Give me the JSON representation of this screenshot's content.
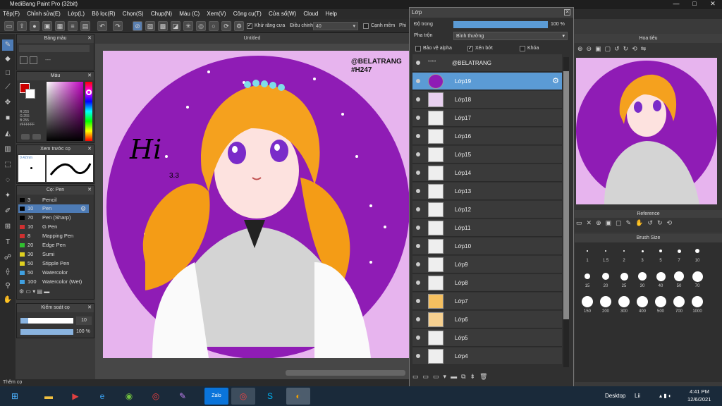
{
  "window_title": "MediBang Paint Pro (32bit)",
  "menu": [
    "Tệp(F)",
    "Chỉnh sửa(E)",
    "Lớp(L)",
    "Bộ lọc(R)",
    "Chọn(S)",
    "Chụp(N)",
    "Màu (C)",
    "Xem(V)",
    "Công cụ(T)",
    "Cửa sổ(W)",
    "Cloud",
    "Help"
  ],
  "toolbar": {
    "antialias_label": "Khử răng cưa",
    "correction_label": "Điều chỉnh",
    "correction_value": "40",
    "snap_label": "Cạnh mềm",
    "extra_label": "Phi"
  },
  "panels": {
    "palette_title": "Bảng màu",
    "color_title": "Màu",
    "rgb": {
      "r": "R:255",
      "g": "G:255",
      "b": "B:255",
      "hex": "#FFFFFF"
    },
    "brush_preview_title": "Xem trước cọ",
    "brush_preview_size": "0.42mm",
    "brush_title": "Cọ: Pen",
    "brushes": [
      {
        "size": "3",
        "name": "Pencil",
        "color": "#000000"
      },
      {
        "size": "10",
        "name": "Pen",
        "color": "#000000",
        "selected": true
      },
      {
        "size": "70",
        "name": "Pen (Sharp)",
        "color": "#000000"
      },
      {
        "size": "10",
        "name": "G Pen",
        "color": "#d03030"
      },
      {
        "size": "8",
        "name": "Mapping Pen",
        "color": "#d03030"
      },
      {
        "size": "20",
        "name": "Edge Pen",
        "color": "#30c030"
      },
      {
        "size": "30",
        "name": "Sumi",
        "color": "#e0d020"
      },
      {
        "size": "50",
        "name": "Stipple Pen",
        "color": "#e0d020"
      },
      {
        "size": "50",
        "name": "Watercolor",
        "color": "#40a0e0"
      },
      {
        "size": "100",
        "name": "Watercolor (Wet)",
        "color": "#40a0e0"
      }
    ],
    "control_title": "Kiểm soát cọ",
    "control_size": "10",
    "control_opacity": "100 %"
  },
  "canvas_title": "Untitled",
  "art": {
    "watermark1": "@BELATRANG",
    "watermark2": "#H247",
    "hi": "Hi",
    "emote": "3.3"
  },
  "layers": {
    "title": "Lớp",
    "opacity_label": "Độ trong",
    "opacity_value": "100 %",
    "opacity_fraction": 1.0,
    "blend_label": "Pha trộn",
    "blend_value": "Bình thường",
    "protect_alpha": "Bảo vệ alpha",
    "clipping": "Xén bớt",
    "lock": "Khóa",
    "items": [
      {
        "name": "@BELATRANG"
      },
      {
        "name": "Lớp19",
        "selected": true
      },
      {
        "name": "Lớp18"
      },
      {
        "name": "Lớp17"
      },
      {
        "name": "Lớp16"
      },
      {
        "name": "Lớp15"
      },
      {
        "name": "Lớp14"
      },
      {
        "name": "Lớp13"
      },
      {
        "name": "Lớp12"
      },
      {
        "name": "Lớp11"
      },
      {
        "name": "Lớp10"
      },
      {
        "name": "Lớp9"
      },
      {
        "name": "Lớp8"
      },
      {
        "name": "Lớp7"
      },
      {
        "name": "Lớp6"
      },
      {
        "name": "Lớp5"
      },
      {
        "name": "Lớp4"
      }
    ]
  },
  "preview_title": "Hoa tiêu",
  "reference_title": "Reference",
  "brush_size_title": "Brush Size",
  "brush_sizes": [
    "1",
    "1.5",
    "2",
    "3",
    "5",
    "7",
    "10",
    "15",
    "20",
    "25",
    "30",
    "40",
    "50",
    "70",
    "150",
    "200",
    "300",
    "400",
    "500",
    "700",
    "1000"
  ],
  "status": "Thêm cọ",
  "taskbar": {
    "desktop": "Desktop",
    "lang": "Lii",
    "time": "4:41 PM",
    "date": "12/6/2021"
  }
}
